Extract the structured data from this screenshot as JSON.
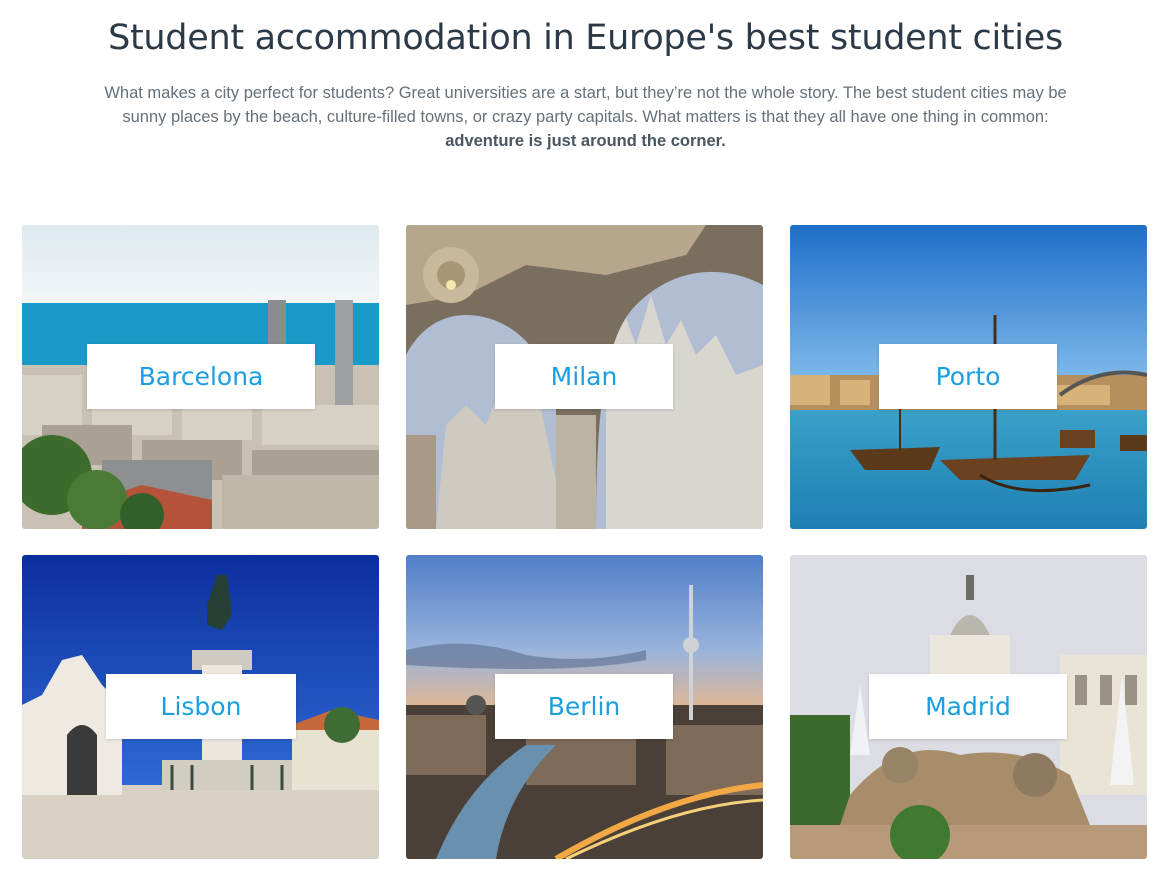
{
  "heading": "Student accommodation in Europe's best student cities",
  "intro": {
    "text": "What makes a city perfect for students? Great universities are a start, but they’re not the whole story. The best student cities may be sunny places by the beach, culture-filled towns, or crazy party capitals. What matters is that they all have one thing in common: ",
    "emphasis": "adventure is just around the corner."
  },
  "cities": [
    {
      "name": "Barcelona"
    },
    {
      "name": "Milan"
    },
    {
      "name": "Porto"
    },
    {
      "name": "Lisbon"
    },
    {
      "name": "Berlin"
    },
    {
      "name": "Madrid"
    }
  ],
  "colors": {
    "accent": "#1b9fe0",
    "heading": "#2c3a47",
    "body_text": "#66707a"
  }
}
